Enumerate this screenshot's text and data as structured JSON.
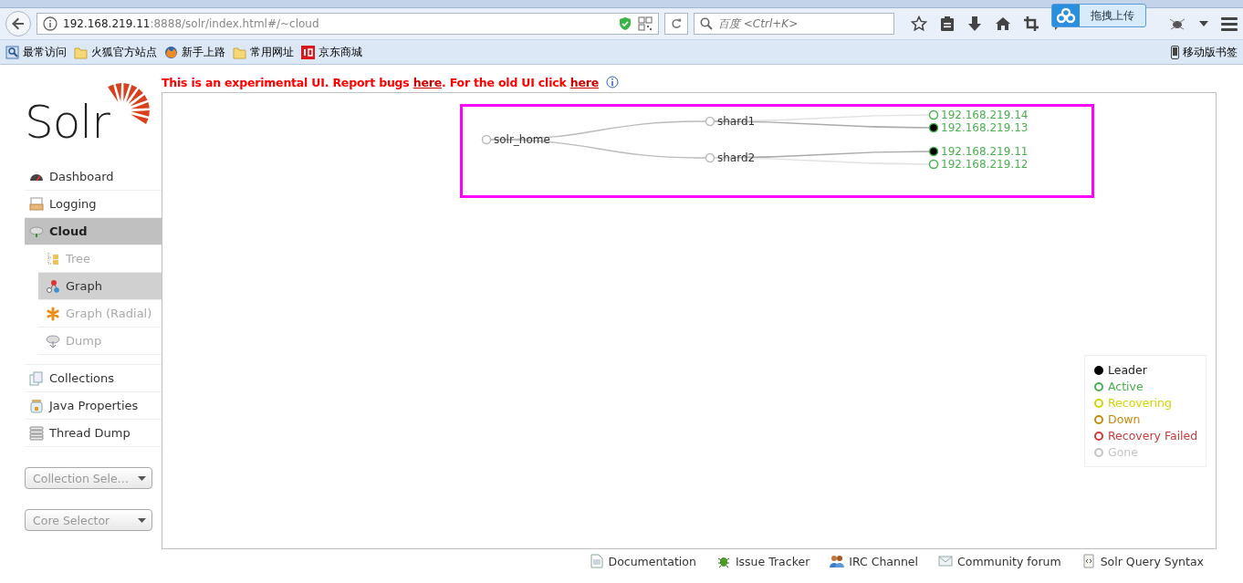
{
  "browser": {
    "url_host": "192.168.219.11",
    "url_rest": ":8888/solr/index.html#/~cloud",
    "search_placeholder": "百度 <Ctrl+K>",
    "upload_label": "拖拽上传",
    "bookmarks": [
      {
        "label": "最常访问"
      },
      {
        "label": "火狐官方站点"
      },
      {
        "label": "新手上路"
      },
      {
        "label": "常用网址"
      },
      {
        "label": "京东商城"
      }
    ],
    "mobile_bookmarks": "移动版书签"
  },
  "banner": {
    "text_1": "This is an experimental UI. Report bugs ",
    "link_1": "here",
    "text_2": ". For the old UI click ",
    "link_2": "here"
  },
  "logo": {
    "text": "Solr"
  },
  "nav": [
    {
      "label": "Dashboard",
      "selected": false
    },
    {
      "label": "Logging",
      "selected": false
    },
    {
      "label": "Cloud",
      "selected": true,
      "children": [
        {
          "label": "Tree",
          "selected": false
        },
        {
          "label": "Graph",
          "selected": true
        },
        {
          "label": "Graph (Radial)",
          "selected": false
        },
        {
          "label": "Dump",
          "selected": false
        }
      ]
    },
    {
      "label": "Collections",
      "selected": false
    },
    {
      "label": "Java Properties",
      "selected": false
    },
    {
      "label": "Thread Dump",
      "selected": false
    }
  ],
  "selectors": [
    {
      "label": "Collection Sele…"
    },
    {
      "label": "Core Selector"
    }
  ],
  "graph": {
    "label": "solr_home",
    "children": [
      {
        "label": "shard1",
        "children": [
          {
            "label": "192.168.219.14",
            "leader": false
          },
          {
            "label": "192.168.219.13",
            "leader": true
          }
        ]
      },
      {
        "label": "shard2",
        "children": [
          {
            "label": "192.168.219.11",
            "leader": true
          },
          {
            "label": "192.168.219.12",
            "leader": false
          }
        ]
      }
    ]
  },
  "legend": [
    {
      "kind": "leader",
      "label": "Leader",
      "color": "#000000"
    },
    {
      "kind": "state",
      "label": "Active",
      "color": "#4caf50"
    },
    {
      "kind": "state",
      "label": "Recovering",
      "color": "#d4d400"
    },
    {
      "kind": "state",
      "label": "Down",
      "color": "#c48a0c"
    },
    {
      "kind": "state",
      "label": "Recovery Failed",
      "color": "#c93b3b"
    },
    {
      "kind": "state",
      "label": "Gone",
      "color": "#c4c4c4"
    }
  ],
  "footer": [
    {
      "label": "Documentation"
    },
    {
      "label": "Issue Tracker"
    },
    {
      "label": "IRC Channel"
    },
    {
      "label": "Community forum"
    },
    {
      "label": "Solr Query Syntax"
    }
  ]
}
